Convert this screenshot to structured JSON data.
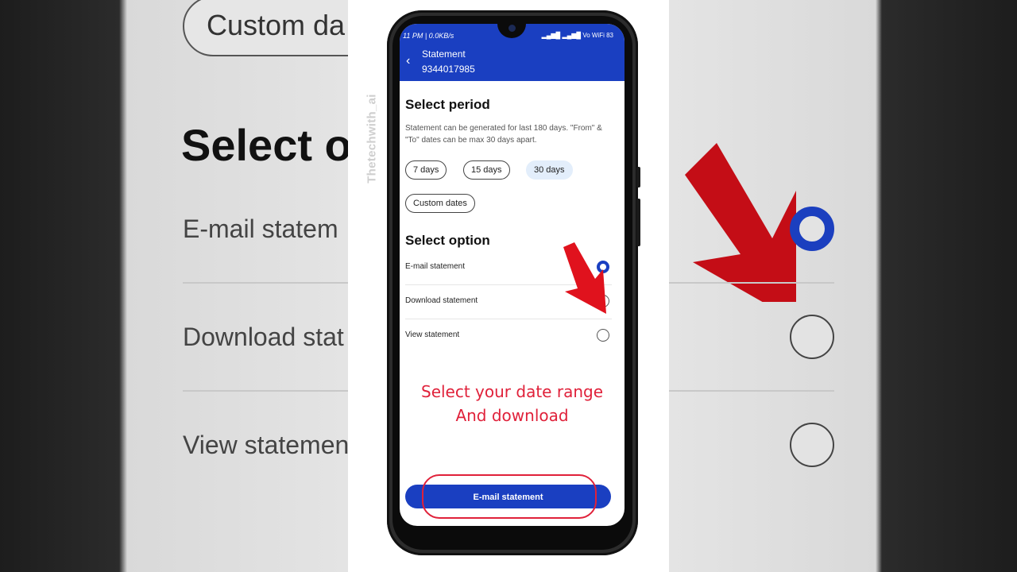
{
  "backdrop": {
    "pill": "Custom da",
    "heading": "Select o",
    "row1": "E-mail statem",
    "row2": "Download stat",
    "row3": "View statemen"
  },
  "watermark": "Thetechwith_ai",
  "status": {
    "left": "11 PM | 0.0KB/s",
    "right": "Vo WiFi 83"
  },
  "header": {
    "title": "Statement",
    "subtitle": "9344017985"
  },
  "period": {
    "heading": "Select period",
    "description": "Statement can be generated for last 180 days. \"From\" & \"To\" dates can be max 30 days apart.",
    "chips": [
      "7 days",
      "15 days",
      "30 days",
      "Custom dates"
    ],
    "selected": "30 days"
  },
  "options": {
    "heading": "Select option",
    "items": [
      "E-mail statement",
      "Download statement",
      "View statement"
    ],
    "selected": "E-mail statement"
  },
  "annotation": {
    "line1": "Select your date range",
    "line2": "And download"
  },
  "cta_label": "E-mail statement",
  "colors": {
    "brand_blue": "#1a3fc1",
    "annotation_red": "#e0213a",
    "arrow_red": "#e0121d"
  }
}
